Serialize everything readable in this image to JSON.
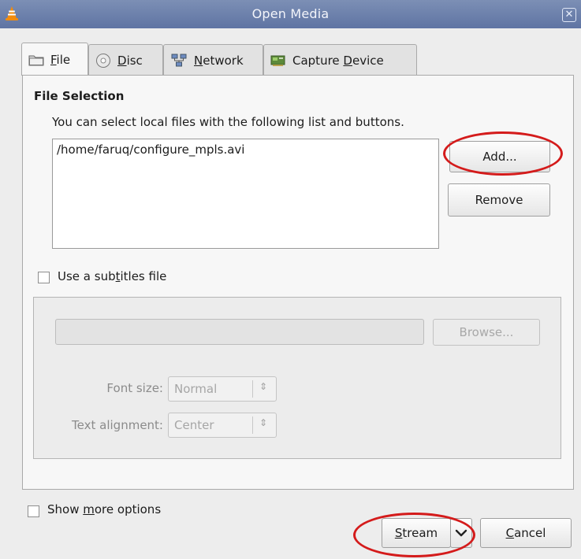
{
  "window": {
    "title": "Open Media",
    "close_glyph": "✕"
  },
  "tabs": [
    {
      "pre": "",
      "u": "F",
      "post": "ile",
      "icon": "folder-icon",
      "active": true
    },
    {
      "pre": "",
      "u": "D",
      "post": "isc",
      "icon": "disc-icon",
      "active": false
    },
    {
      "pre": "",
      "u": "N",
      "post": "etwork",
      "icon": "network-icon",
      "active": false
    },
    {
      "pre": "Capture ",
      "u": "D",
      "post": "evice",
      "icon": "capture-card-icon",
      "active": false
    }
  ],
  "file_selection": {
    "title": "File Selection",
    "description": "You can select local files with the following list and buttons.",
    "files": [
      "/home/faruq/configure_mpls.avi"
    ],
    "add_label": "Add...",
    "remove_label": "Remove"
  },
  "subtitles": {
    "checkbox_pre": "Use a sub",
    "checkbox_u": "t",
    "checkbox_post": "itles file",
    "checked": false,
    "path_value": "",
    "browse_label": "Browse...",
    "font_size_label": "Font size:",
    "font_size_value": "Normal",
    "alignment_label": "Text alignment:",
    "alignment_value": "Center"
  },
  "options": {
    "more_pre": "Show ",
    "more_u": "m",
    "more_post": "ore options",
    "checked": false
  },
  "actions": {
    "stream_u": "S",
    "stream_post": "tream",
    "cancel_u": "C",
    "cancel_post": "ancel"
  },
  "colors": {
    "titlebar": "#6a7fac",
    "annotation": "#d41b1b"
  }
}
